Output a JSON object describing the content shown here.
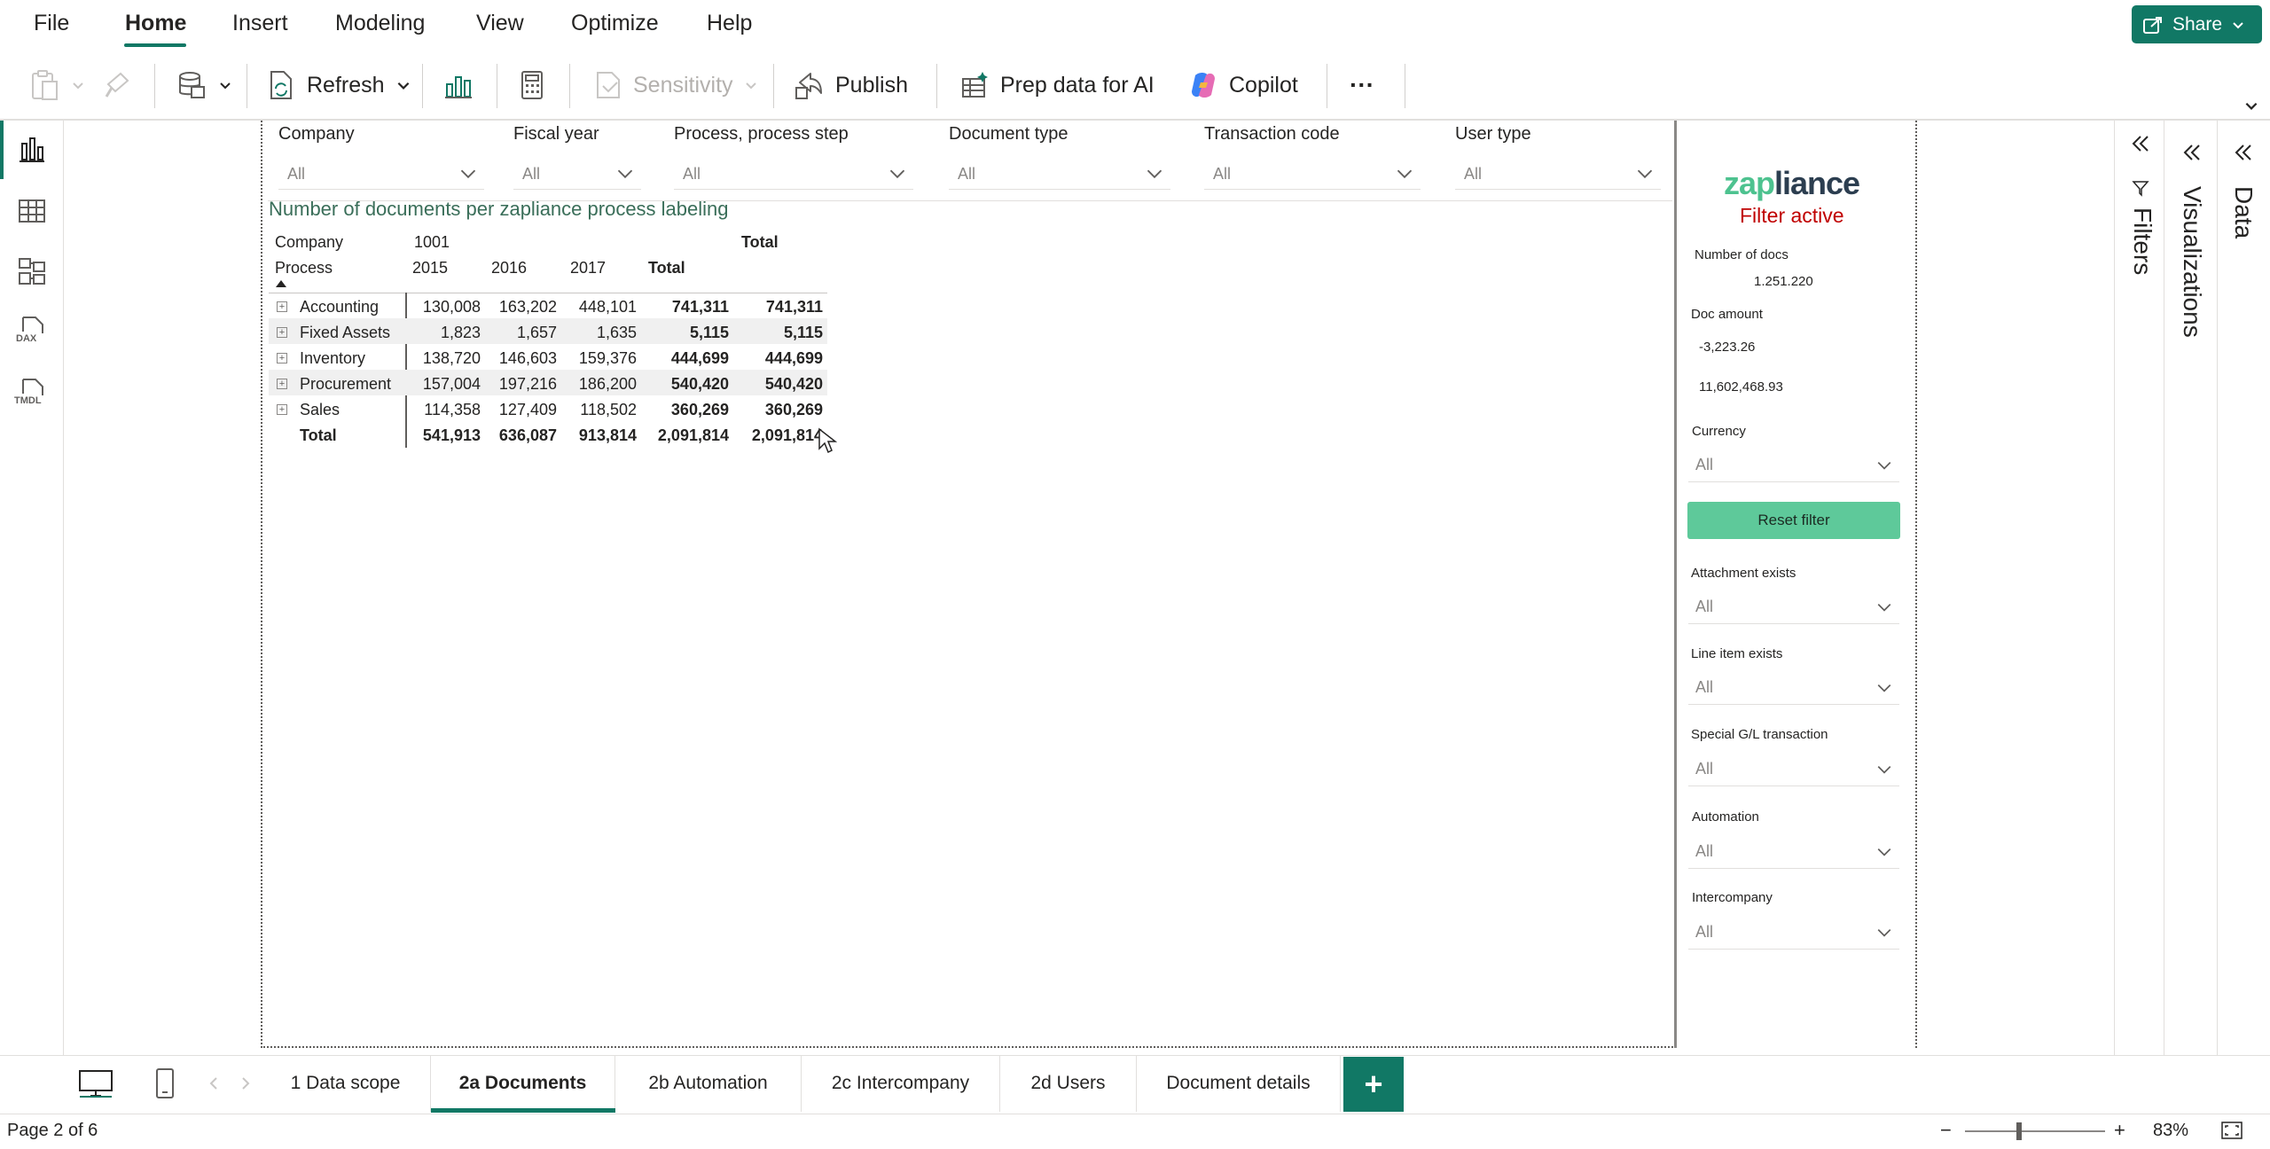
{
  "menu": {
    "items": [
      "File",
      "Home",
      "Insert",
      "Modeling",
      "View",
      "Optimize",
      "Help"
    ],
    "active": "Home",
    "share_label": "Share"
  },
  "ribbon": {
    "refresh_label": "Refresh",
    "sensitivity_label": "Sensitivity",
    "publish_label": "Publish",
    "prep_label": "Prep data for AI",
    "copilot_label": "Copilot",
    "more_label": "···"
  },
  "rail": {
    "items": [
      "report-view",
      "table-view",
      "model-view",
      "dax-query-view",
      "tmdl-view"
    ],
    "dax_text": "DAX",
    "tmdl_text": "TMDL"
  },
  "slicers": [
    {
      "label": "Company",
      "value": "All"
    },
    {
      "label": "Fiscal year",
      "value": "All"
    },
    {
      "label": "Process, process step",
      "value": "All"
    },
    {
      "label": "Document type",
      "value": "All"
    },
    {
      "label": "Transaction code",
      "value": "All"
    },
    {
      "label": "User type",
      "value": "All"
    }
  ],
  "matrix": {
    "title": "Number of documents per zapliance process labeling",
    "company_label": "Company",
    "company_value": "1001",
    "total_header": "Total",
    "process_label": "Process",
    "years": [
      "2015",
      "2016",
      "2017"
    ],
    "year_total": "Total",
    "rows": [
      {
        "name": "Accounting",
        "v2015": "130,008",
        "v2016": "163,202",
        "v2017": "448,101",
        "total": "741,311",
        "grand": "741,311"
      },
      {
        "name": "Fixed Assets",
        "v2015": "1,823",
        "v2016": "1,657",
        "v2017": "1,635",
        "total": "5,115",
        "grand": "5,115"
      },
      {
        "name": "Inventory",
        "v2015": "138,720",
        "v2016": "146,603",
        "v2017": "159,376",
        "total": "444,699",
        "grand": "444,699"
      },
      {
        "name": "Procurement",
        "v2015": "157,004",
        "v2016": "197,216",
        "v2017": "186,200",
        "total": "540,420",
        "grand": "540,420"
      },
      {
        "name": "Sales",
        "v2015": "114,358",
        "v2016": "127,409",
        "v2017": "118,502",
        "total": "360,269",
        "grand": "360,269"
      }
    ],
    "total_row": {
      "name": "Total",
      "v2015": "541,913",
      "v2016": "636,087",
      "v2017": "913,814",
      "total": "2,091,814",
      "grand": "2,091,814"
    }
  },
  "side": {
    "logo_prefix": "zap",
    "logo_suffix": "liance",
    "filter_status": "Filter active",
    "num_docs_label": "Number of docs",
    "num_docs_value": "1.251.220",
    "doc_amount_label": "Doc amount",
    "doc_amount_min": "-3,223.26",
    "doc_amount_max": "11,602,468.93",
    "currency_label": "Currency",
    "currency_value": "All",
    "reset_label": "Reset filter",
    "attachment_label": "Attachment exists",
    "attachment_value": "All",
    "lineitem_label": "Line item exists",
    "lineitem_value": "All",
    "special_label": "Special G/L transaction",
    "special_value": "All",
    "automation_label": "Automation",
    "automation_value": "All",
    "intercompany_label": "Intercompany",
    "intercompany_value": "All"
  },
  "panes": {
    "filters": "Filters",
    "visualizations": "Visualizations",
    "data": "Data"
  },
  "tabs": {
    "items": [
      "1 Data scope",
      "2a Documents",
      "2b Automation",
      "2c Intercompany",
      "2d Users",
      "Document details"
    ],
    "active": "2a Documents",
    "add": "+"
  },
  "status": {
    "page": "Page 2 of 6",
    "zoom": "83%"
  },
  "colors": {
    "accent": "#117865",
    "zap_green": "#4dc28f",
    "filter_red": "#c00000",
    "reset_bg": "#5ec99a"
  }
}
